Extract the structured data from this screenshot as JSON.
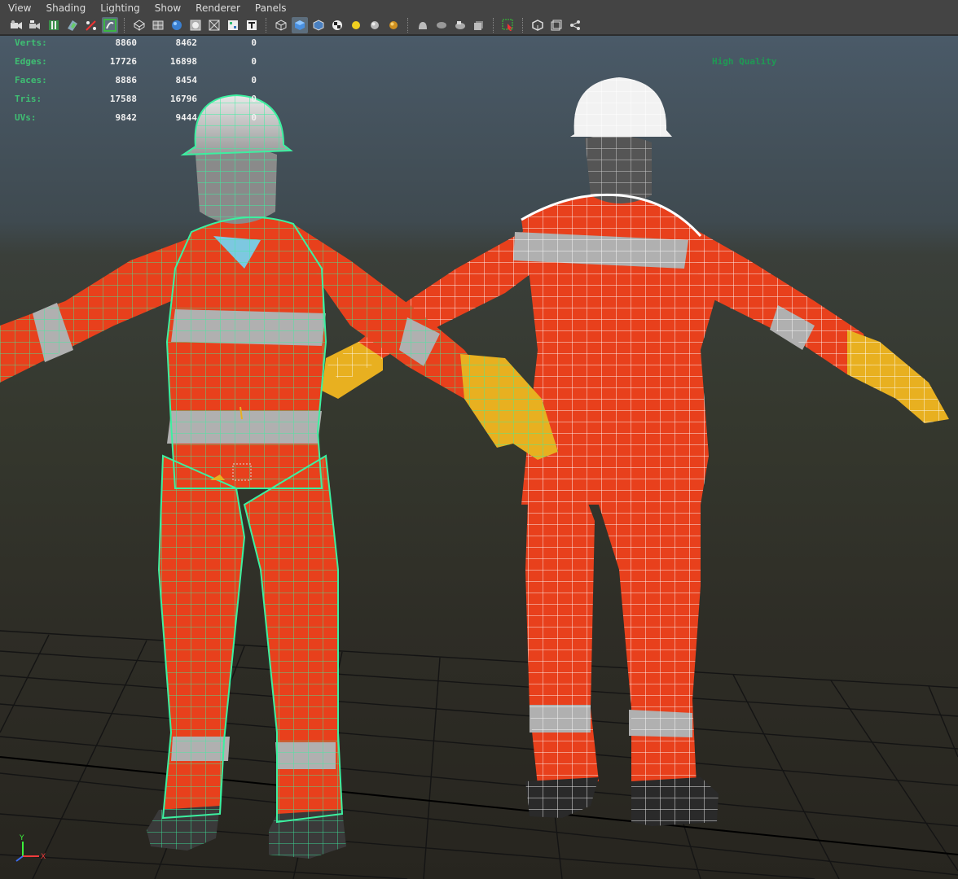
{
  "menubar": {
    "items": [
      {
        "label": "View"
      },
      {
        "label": "Shading"
      },
      {
        "label": "Lighting"
      },
      {
        "label": "Show"
      },
      {
        "label": "Renderer"
      },
      {
        "label": "Panels"
      }
    ]
  },
  "toolbar": {
    "icons": [
      "select-camera-icon",
      "camera-attributes-icon",
      "bookmark-icon",
      "image-plane-icon",
      "grease-pencil-icon",
      "isolate-select-icon",
      "wireframe-icon",
      "smooth-shade-icon",
      "wireframe-on-shaded-icon",
      "xray-icon",
      "default-material-icon",
      "textured-icon",
      "lighting-default-icon",
      "lighting-all-icon",
      "lighting-selected-icon",
      "shadows-icon",
      "ambient-occlusion-icon",
      "motion-blur-icon",
      "depth-of-field-icon",
      "select-tool-icon",
      "resolution-gate-icon",
      "film-gate-icon",
      "node-editor-icon"
    ]
  },
  "hud": {
    "rows": [
      {
        "label": "Verts:",
        "v1": "8860",
        "v2": "8462",
        "v3": "0"
      },
      {
        "label": "Edges:",
        "v1": "17726",
        "v2": "16898",
        "v3": "0"
      },
      {
        "label": "Faces:",
        "v1": "8886",
        "v2": "8454",
        "v3": "0"
      },
      {
        "label": "Tris:",
        "v1": "17588",
        "v2": "16796",
        "v3": "0"
      },
      {
        "label": "UVs:",
        "v1": "9842",
        "v2": "9444",
        "v3": "0"
      }
    ],
    "quality": "High Quality"
  },
  "colors": {
    "suit": "#e8401c",
    "selected_wire": "#3cf0a0",
    "white_wire": "#ffffff",
    "glove": "#e8b020",
    "reflective": "#b0b0b0",
    "hud_label": "#3fbf73"
  },
  "axis": {
    "y_label": "Y",
    "x_label": "X"
  }
}
